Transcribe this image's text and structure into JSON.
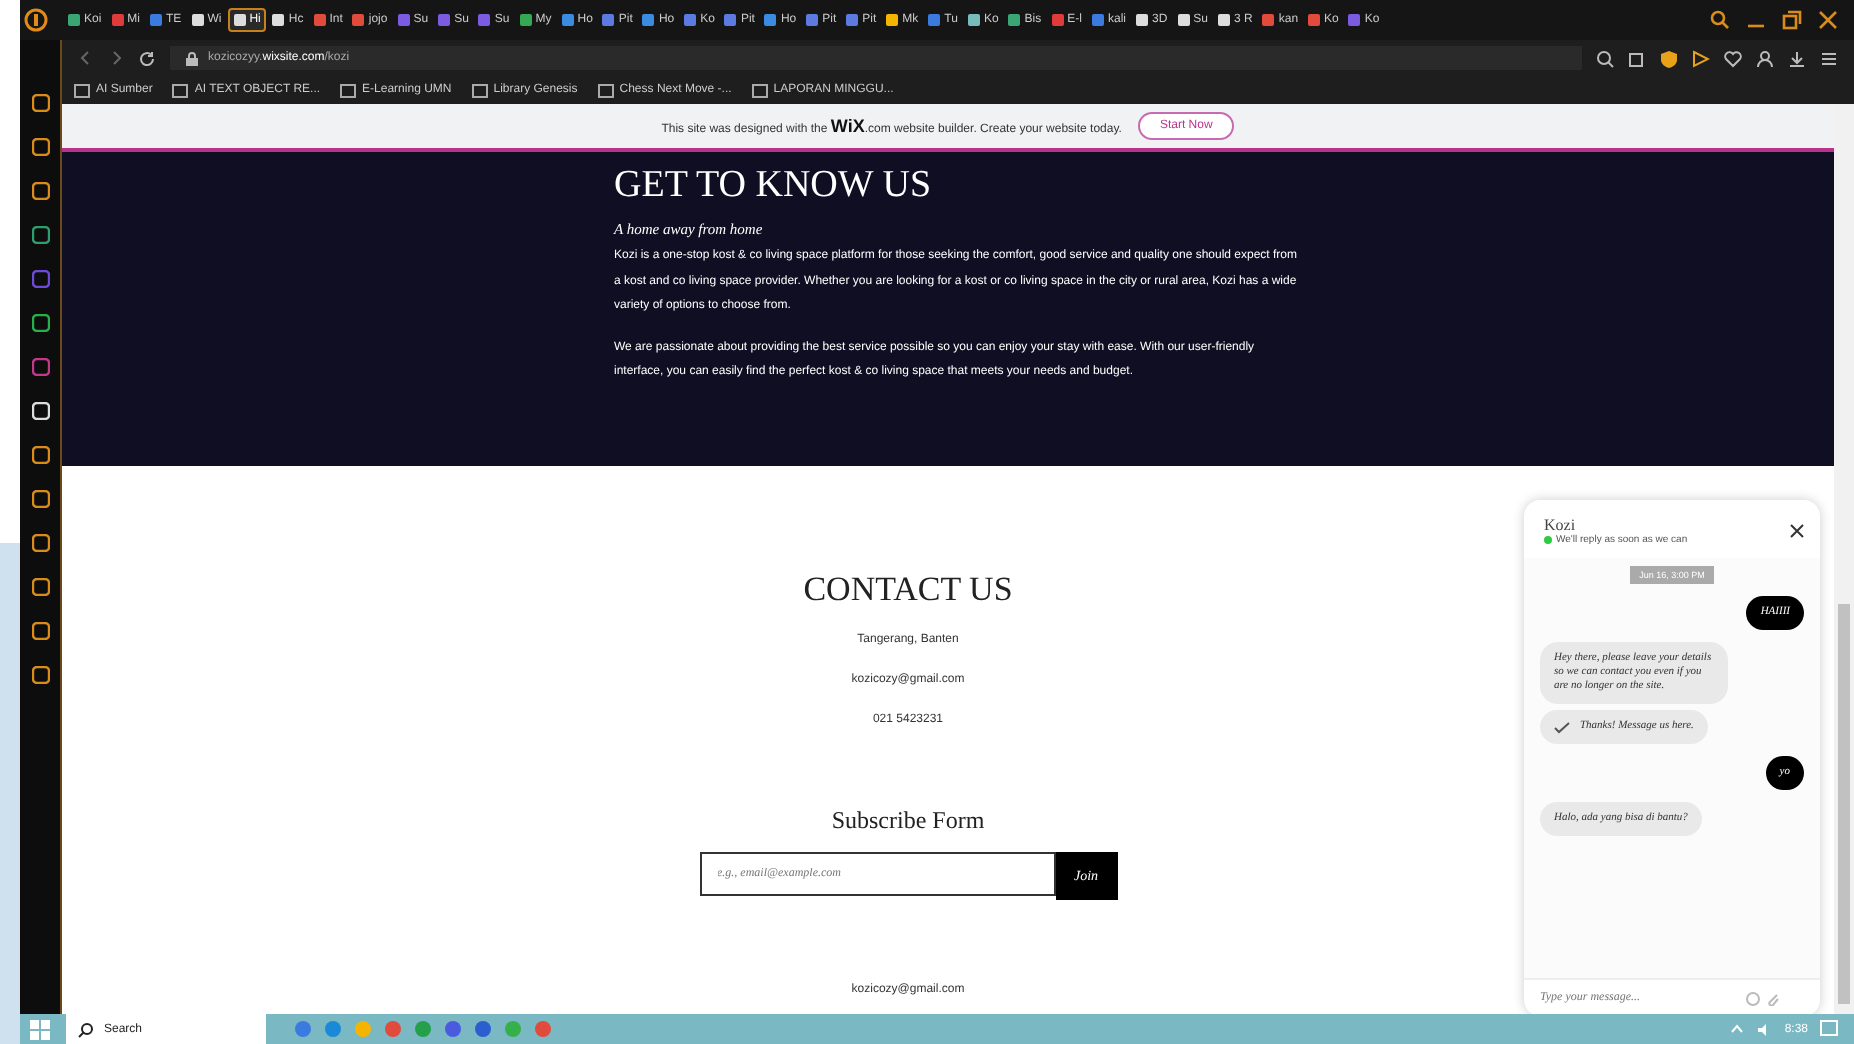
{
  "browser": {
    "tabs": [
      {
        "label": "Koi",
        "selected": false
      },
      {
        "label": "Mi",
        "selected": false
      },
      {
        "label": "TE",
        "selected": false
      },
      {
        "label": "Wi",
        "selected": false
      },
      {
        "label": "Hi",
        "selected": true
      },
      {
        "label": "Hc",
        "selected": false
      },
      {
        "label": "Int",
        "selected": false
      },
      {
        "label": "jojo",
        "selected": false
      },
      {
        "label": "Su",
        "selected": false
      },
      {
        "label": "Su",
        "selected": false
      },
      {
        "label": "Su",
        "selected": false
      },
      {
        "label": "My",
        "selected": false
      },
      {
        "label": "Ho",
        "selected": false
      },
      {
        "label": "Pit",
        "selected": false
      },
      {
        "label": "Ho",
        "selected": false
      },
      {
        "label": "Ko",
        "selected": false
      },
      {
        "label": "Pit",
        "selected": false
      },
      {
        "label": "Ho",
        "selected": false
      },
      {
        "label": "Pit",
        "selected": false
      },
      {
        "label": "Pit",
        "selected": false
      },
      {
        "label": "Mk",
        "selected": false
      },
      {
        "label": "Tu",
        "selected": false
      },
      {
        "label": "Ko",
        "selected": false
      },
      {
        "label": "Bis",
        "selected": false
      },
      {
        "label": "E-l",
        "selected": false
      },
      {
        "label": "kali",
        "selected": false
      },
      {
        "label": "3D",
        "selected": false
      },
      {
        "label": "Su",
        "selected": false
      },
      {
        "label": "3 R",
        "selected": false
      },
      {
        "label": "kan",
        "selected": false
      },
      {
        "label": "Ko",
        "selected": false
      },
      {
        "label": "Ko",
        "selected": false
      }
    ],
    "url_host": "kozicozyy.",
    "url_domain": "wixsite.com",
    "url_path": "/kozi",
    "bookmarks": [
      "AI Sumber",
      "AI TEXT OBJECT RE...",
      "E-Learning UMN",
      "Library Genesis",
      "Chess Next Move -...",
      "LAPORAN MINGGU..."
    ]
  },
  "wix_banner": {
    "text_before": "This site was designed with the",
    "brand": "WiX",
    "text_after": ".com website builder. Create your website today.",
    "button": "Start Now"
  },
  "about": {
    "title": "GET TO KNOW US",
    "tagline": "A home away from home",
    "paragraphs": [
      "Kozi is a one-stop kost & co living space platform for those seeking the comfort, good service and quality one should expect from a kost and co living space provider. Whether you are looking for a kost or co living space in the city or rural area, Kozi has a wide variety of options to choose from.",
      "We are passionate about providing the best service possible so you can enjoy your stay with ease. With our user-friendly interface, you can easily find the perfect kost & co living space that meets your needs and budget."
    ]
  },
  "contact": {
    "title": "CONTACT US",
    "lines": [
      "Tangerang, Banten",
      "kozicozy@gmail.com",
      "021 5423231"
    ]
  },
  "subscribe": {
    "title": "Subscribe Form",
    "placeholder": "e.g., email@example.com",
    "button": "Join"
  },
  "footer": {
    "email": "kozicozy@gmail.com"
  },
  "chat": {
    "name": "Kozi",
    "status": "We'll reply as soon as we can",
    "online": true,
    "date": "Jun 16, 3:00 PM",
    "messages": [
      {
        "kind": "outgoing",
        "text": "HAIIII"
      },
      {
        "kind": "incoming",
        "text": "Hey there, please leave your details so we can contact you even if you are no longer on the site."
      },
      {
        "kind": "receipt",
        "text": "Thanks! Message us here."
      },
      {
        "kind": "outgoing",
        "text": "yo"
      },
      {
        "kind": "incoming",
        "text": "Halo, ada yang bisa di bantu?"
      }
    ],
    "placeholder": "Type your message..."
  },
  "taskbar": {
    "search": "Search",
    "time": "8:38"
  }
}
